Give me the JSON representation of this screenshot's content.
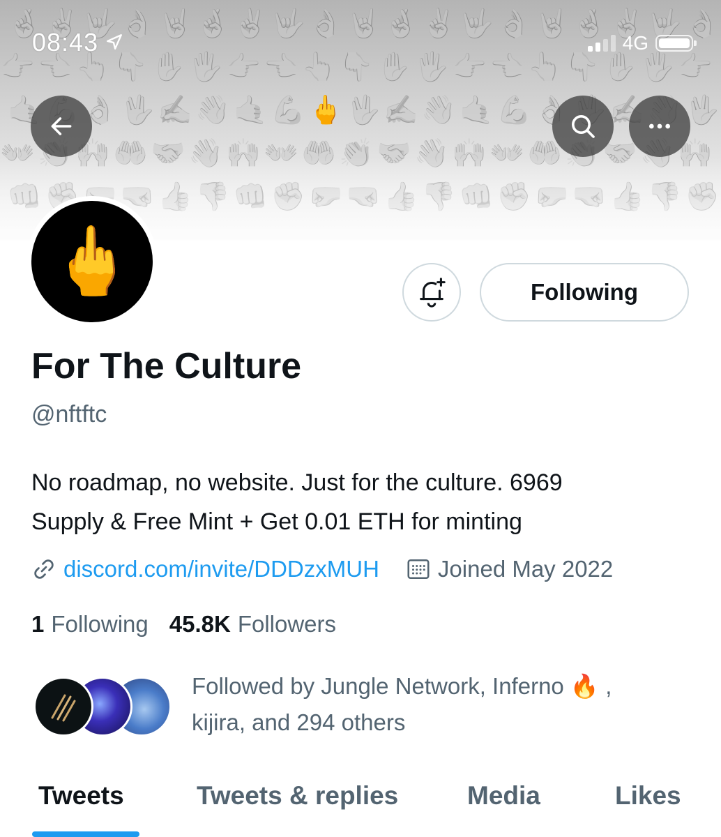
{
  "status_bar": {
    "time": "08:43",
    "network": "4G",
    "location_icon": "location-arrow-icon",
    "signal_icon": "signal-bars-icon",
    "battery_icon": "battery-icon"
  },
  "header": {
    "back_icon": "arrow-left-icon",
    "search_icon": "search-icon",
    "more_icon": "more-dots-icon",
    "banner_emoji_rows": [
      [
        "🤞",
        "✌️",
        "🤟",
        "👌",
        "🤘",
        "🤞",
        "✌️",
        "🤟",
        "👌",
        "🤘",
        "🤞",
        "✌️",
        "🤟",
        "👌",
        "🤘",
        "🤞",
        "✌️",
        "🤟",
        "👌"
      ],
      [
        "👉",
        "👈",
        "👆",
        "👇",
        "✋",
        "🖐",
        "👉",
        "👈",
        "👆",
        "👇",
        "✋",
        "🖐",
        "👉",
        "👈",
        "👆",
        "👇",
        "✋",
        "🖐",
        "👉"
      ],
      [
        "🤙",
        "💪",
        "👌",
        "🖖",
        "✍️",
        "👋",
        "🤙",
        "💪",
        "🖕",
        "🖖",
        "✍️",
        "👋",
        "🤙",
        "💪",
        "👌",
        "🖖",
        "✍️",
        "👋",
        "🖖"
      ],
      [
        "👐",
        "👏",
        "🙌",
        "🤲",
        "🤝",
        "👋",
        "🙌",
        "👐",
        "🤲",
        "👏",
        "🤝",
        "👋",
        "🙌",
        "👐",
        "🤲",
        "👏",
        "🤝",
        "👋",
        "🙌"
      ],
      [
        "👊",
        "✊",
        "🤛",
        "🤜",
        "👍",
        "👎",
        "👊",
        "✊",
        "🤛",
        "🤜",
        "👍",
        "👎",
        "👊",
        "✊",
        "🤛",
        "🤜",
        "👍",
        "👎",
        "✊"
      ]
    ]
  },
  "profile": {
    "avatar_emoji": "🖕",
    "display_name": "For The Culture",
    "handle": "@nftftc",
    "bio_line1": "No roadmap, no website. Just for the culture. 6969",
    "bio_line2": "Supply & Free Mint + Get 0.01 ETH for minting",
    "link_icon": "link-icon",
    "link": "discord.com/invite/DDDzxMUH",
    "calendar_icon": "calendar-icon",
    "joined": "Joined May 2022",
    "following_count": "1",
    "following_label": "Following",
    "followers_count": "45.8K",
    "followers_label": "Followers"
  },
  "actions": {
    "notify_icon": "bell-plus-icon",
    "following_button": "Following"
  },
  "followed_by": {
    "line1": "Followed by Jungle Network, Inferno 🔥 ,",
    "line2": "kijira, and 294 others"
  },
  "tabs": [
    {
      "label": "Tweets",
      "active": true
    },
    {
      "label": "Tweets & replies",
      "active": false
    },
    {
      "label": "Media",
      "active": false
    },
    {
      "label": "Likes",
      "active": false
    }
  ],
  "colors": {
    "accent": "#1d9bf0",
    "text_primary": "#0f1419",
    "text_secondary": "#536471",
    "border": "#cfd9de"
  }
}
